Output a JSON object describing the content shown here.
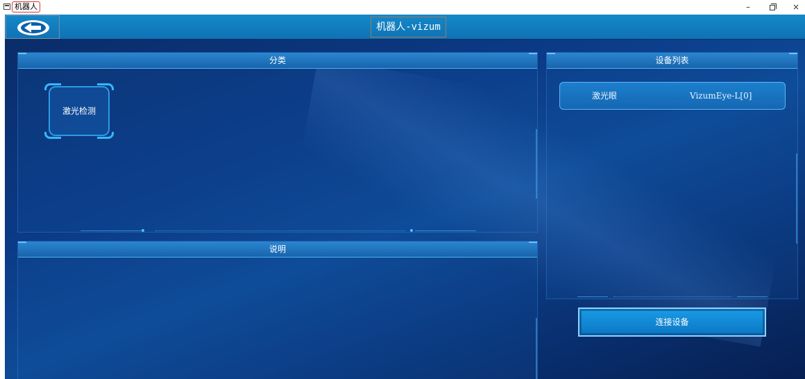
{
  "window": {
    "title": "机器人",
    "controls": {
      "minimize": "–",
      "close": "×"
    }
  },
  "header": {
    "title": "机器人-vizum",
    "back_icon": "back-arrow-icon"
  },
  "category_panel": {
    "title": "分类",
    "items": [
      {
        "label": "激光检测"
      }
    ]
  },
  "description_panel": {
    "title": "说明"
  },
  "device_panel": {
    "title": "设备列表",
    "devices": [
      {
        "name": "激光眼",
        "id": "VizumEye-L[0]"
      }
    ]
  },
  "actions": {
    "connect_label": "连接设备"
  },
  "colors": {
    "background": "#0b3a86",
    "header": "#1489c8",
    "accent": "#35b8ff"
  }
}
